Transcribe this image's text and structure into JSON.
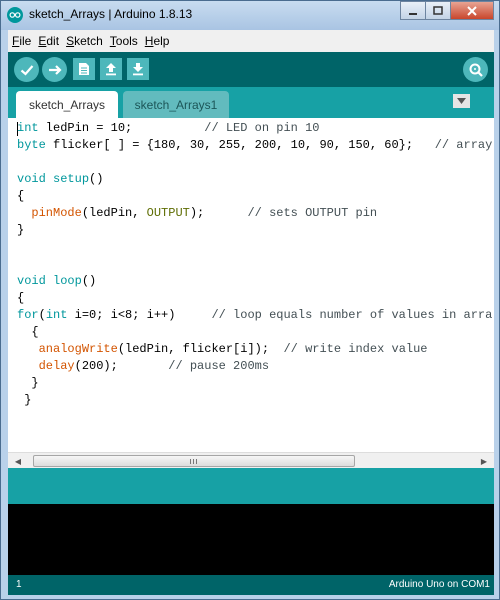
{
  "window": {
    "title": "sketch_Arrays | Arduino 1.8.13"
  },
  "menubar": [
    {
      "key": "F",
      "rest": "ile"
    },
    {
      "key": "E",
      "rest": "dit"
    },
    {
      "key": "S",
      "rest": "ketch"
    },
    {
      "key": "T",
      "rest": "ools"
    },
    {
      "key": "H",
      "rest": "elp"
    }
  ],
  "toolbar": {
    "buttons": [
      "verify-icon",
      "upload-icon",
      "new-icon",
      "open-icon",
      "save-icon"
    ],
    "serial_monitor_icon": "serial-monitor-icon"
  },
  "tabs": [
    "sketch_Arrays",
    "sketch_Arrays1"
  ],
  "editor": {
    "lines": [
      {
        "parts": [
          {
            "t": "int",
            "c": "kw"
          },
          {
            "t": " ledPin = 10;          "
          },
          {
            "t": "// LED on pin 10",
            "c": "cm"
          }
        ]
      },
      {
        "parts": [
          {
            "t": "byte",
            "c": "kw"
          },
          {
            "t": " flicker[ ] = {180, 30, 255, 200, 10, 90, 150, 60};   "
          },
          {
            "t": "// array",
            "c": "cm"
          }
        ]
      },
      {
        "parts": []
      },
      {
        "parts": [
          {
            "t": "void",
            "c": "kw"
          },
          {
            "t": " "
          },
          {
            "t": "setup",
            "c": "kw"
          },
          {
            "t": "()"
          }
        ]
      },
      {
        "parts": [
          {
            "t": "{"
          }
        ]
      },
      {
        "parts": [
          {
            "t": "  "
          },
          {
            "t": "pinMode",
            "c": "fn"
          },
          {
            "t": "(ledPin, "
          },
          {
            "t": "OUTPUT",
            "c": "ct"
          },
          {
            "t": ");      "
          },
          {
            "t": "// sets OUTPUT pin",
            "c": "cm"
          }
        ]
      },
      {
        "parts": [
          {
            "t": "}"
          }
        ]
      },
      {
        "parts": []
      },
      {
        "parts": []
      },
      {
        "parts": [
          {
            "t": "void",
            "c": "kw"
          },
          {
            "t": " "
          },
          {
            "t": "loop",
            "c": "kw"
          },
          {
            "t": "()"
          }
        ]
      },
      {
        "parts": [
          {
            "t": "{"
          }
        ]
      },
      {
        "parts": [
          {
            "t": "for",
            "c": "kw"
          },
          {
            "t": "("
          },
          {
            "t": "int",
            "c": "kw"
          },
          {
            "t": " i=0; i<8; i++)     "
          },
          {
            "t": "// loop equals number of values in arra",
            "c": "cm"
          }
        ]
      },
      {
        "parts": [
          {
            "t": "  {"
          }
        ]
      },
      {
        "parts": [
          {
            "t": "   "
          },
          {
            "t": "analogWrite",
            "c": "fn"
          },
          {
            "t": "(ledPin, flicker[i]);  "
          },
          {
            "t": "// write index value",
            "c": "cm"
          }
        ]
      },
      {
        "parts": [
          {
            "t": "   "
          },
          {
            "t": "delay",
            "c": "fn"
          },
          {
            "t": "(200);       "
          },
          {
            "t": "// pause 200ms",
            "c": "cm"
          }
        ]
      },
      {
        "parts": [
          {
            "t": "  }"
          }
        ]
      },
      {
        "parts": [
          {
            "t": " }"
          }
        ]
      }
    ]
  },
  "status": {
    "line": "1",
    "board": "Arduino Uno on COM1"
  },
  "colors": {
    "toolbar": "#006468",
    "tabbar": "#17a1a5",
    "button": "#4db7bb",
    "keyword": "#00979c",
    "function": "#d35400",
    "constant": "#5e6d03",
    "comment": "#434f54"
  }
}
